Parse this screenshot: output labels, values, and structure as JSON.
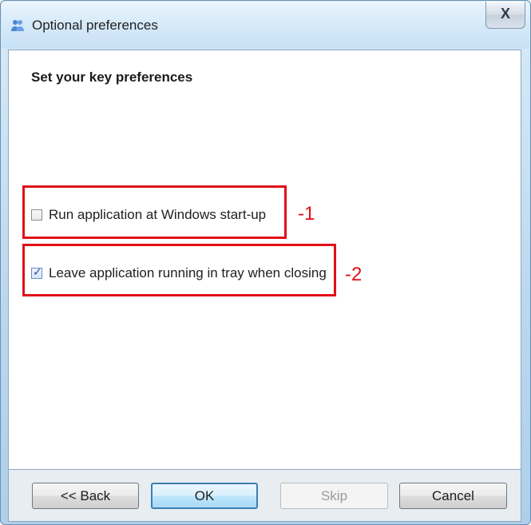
{
  "window": {
    "title": "Optional preferences",
    "close_symbol": "X",
    "icon": "users-icon"
  },
  "content": {
    "heading": "Set your key preferences",
    "options": [
      {
        "label": "Run application at Windows start-up",
        "checked": false,
        "annotation": "-1"
      },
      {
        "label": "Leave application running in tray when closing",
        "checked": true,
        "annotation": "-2"
      }
    ]
  },
  "buttons": {
    "back": "<< Back",
    "ok": "OK",
    "skip": "Skip",
    "cancel": "Cancel"
  },
  "colors": {
    "annotation": "#e10e18",
    "default_button": "#3c7fb1"
  }
}
